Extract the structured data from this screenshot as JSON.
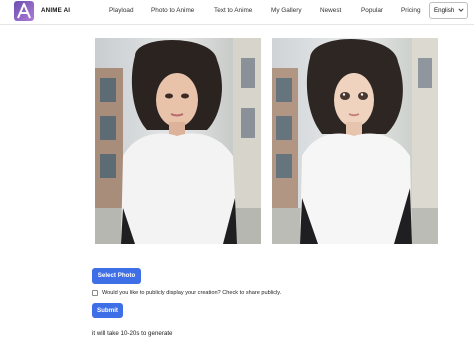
{
  "header": {
    "brand": "ANIME AI",
    "nav": [
      {
        "label": "Playload"
      },
      {
        "label": "Photo to Anime"
      },
      {
        "label": "Text to Anime"
      },
      {
        "label": "My Gallery"
      },
      {
        "label": "Newest"
      },
      {
        "label": "Popular"
      },
      {
        "label": "Pricing"
      }
    ],
    "language": {
      "selected": "English"
    }
  },
  "icons": {
    "logo": "anime-ai-logo-icon",
    "language_caret": "chevron-down-icon"
  },
  "main": {
    "images": {
      "original": "original-photo",
      "result": "anime-result-photo"
    },
    "select_photo_label": "Select Photo",
    "share_consent_label": "Would you like to publicly display your creation? Check to share publicly.",
    "share_checked": false,
    "submit_label": "Submit",
    "generation_note": "it will take 10-20s to generate"
  },
  "colors": {
    "accent": "#3f6fe6",
    "logo_bg": "#7e5ab8"
  }
}
